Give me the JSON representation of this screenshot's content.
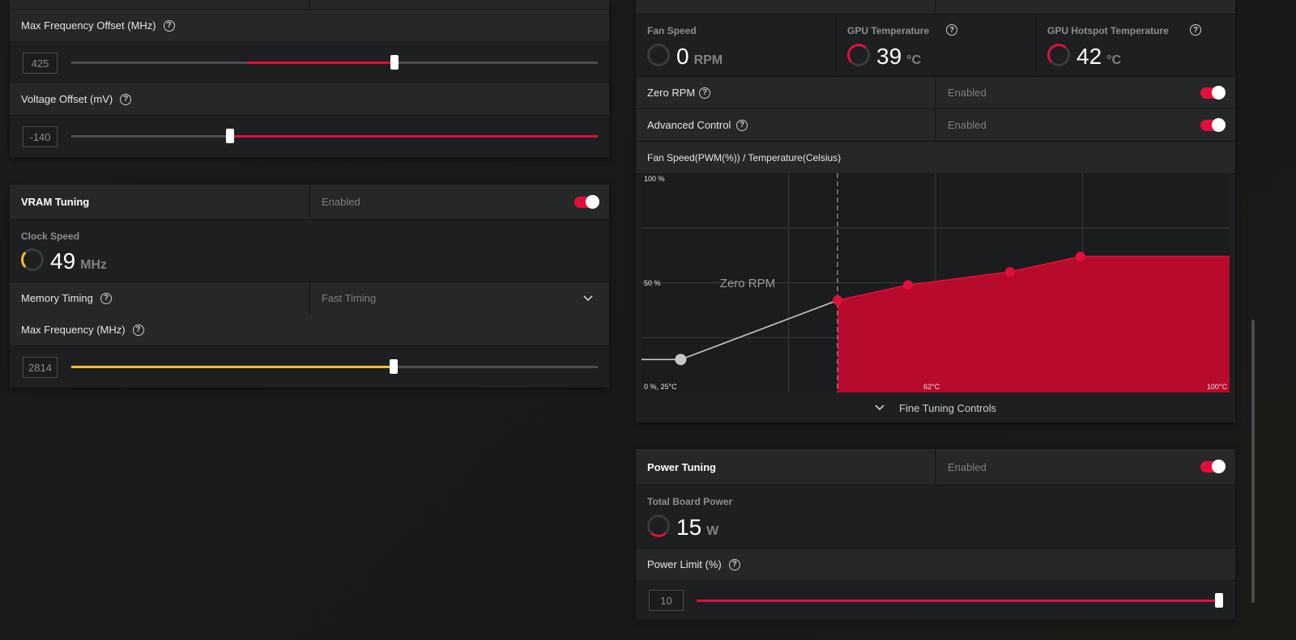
{
  "core": {
    "max_freq_offset_label": "Max Frequency Offset (MHz)",
    "max_freq_offset_value": "425",
    "max_freq_offset_fraction": 0.62,
    "voltage_offset_label": "Voltage Offset (mV)",
    "voltage_offset_value": "-140",
    "voltage_offset_fraction": 0.3
  },
  "vram": {
    "title": "VRAM Tuning",
    "status": "Enabled",
    "clock_speed_label": "Clock Speed",
    "clock_speed_value": "49",
    "clock_speed_unit": "MHz",
    "memory_timing_label": "Memory Timing",
    "memory_timing_value": "Fast Timing",
    "max_freq_label": "Max Frequency (MHz)",
    "max_freq_value": "2814",
    "max_freq_fraction": 0.61
  },
  "fan": {
    "fan_speed_label": "Fan Speed",
    "fan_speed_value": "0",
    "fan_speed_unit": "RPM",
    "gpu_temp_label": "GPU Temperature",
    "gpu_temp_value": "39",
    "gpu_temp_unit": "°C",
    "hotspot_label": "GPU Hotspot Temperature",
    "hotspot_value": "42",
    "hotspot_unit": "°C",
    "zero_rpm_label": "Zero RPM",
    "zero_rpm_status": "Enabled",
    "advanced_label": "Advanced Control",
    "advanced_status": "Enabled",
    "curve_title": "Fan Speed(PWM(%)) / Temperature(Celsius)",
    "fine_tuning_label": "Fine Tuning Controls"
  },
  "chart_data": {
    "type": "area",
    "title": "Fan Speed(PWM(%)) / Temperature(Celsius)",
    "x_unit": "°C",
    "xlim": [
      25,
      100
    ],
    "ylim": [
      0,
      100
    ],
    "tick_labels": {
      "y_top": "100 %",
      "y_mid": "50 %",
      "origin": "0 %, 25°C",
      "x_mid": "62°C",
      "x_max": "100°C"
    },
    "annotation": "Zero RPM",
    "zero_rpm_threshold_x": 50,
    "points": [
      {
        "x": 25,
        "y": 15
      },
      {
        "x": 30,
        "y": 15
      },
      {
        "x": 50,
        "y": 42
      },
      {
        "x": 59,
        "y": 49
      },
      {
        "x": 72,
        "y": 55
      },
      {
        "x": 81,
        "y": 62
      },
      {
        "x": 100,
        "y": 62
      }
    ],
    "colors": {
      "active_fill": "#b70a2c",
      "active_line": "#e0103a",
      "inactive_line": "#c8c8c8"
    }
  },
  "power": {
    "title": "Power Tuning",
    "status": "Enabled",
    "tbp_label": "Total Board Power",
    "tbp_value": "15",
    "tbp_unit": "W",
    "limit_label": "Power Limit (%)",
    "limit_value": "10",
    "limit_fraction": 1.0
  },
  "icons": {
    "help": "?",
    "chevron_down": "⌄"
  },
  "colors": {
    "accent_red": "#e0103a",
    "accent_yellow": "#f3c02d",
    "panel": "#1e1f21",
    "header": "#262729"
  }
}
